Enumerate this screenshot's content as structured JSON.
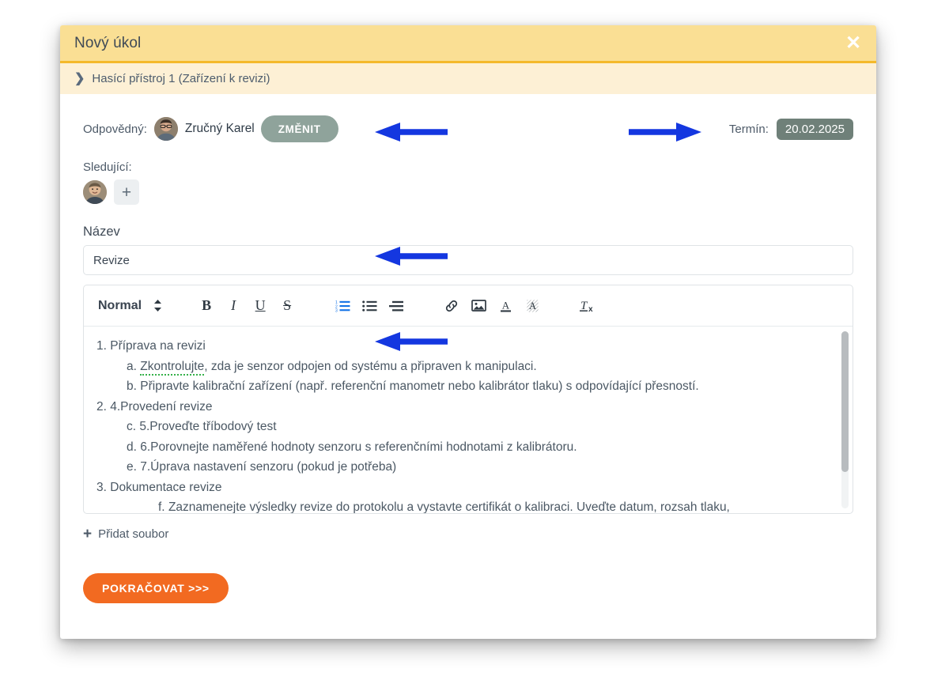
{
  "window": {
    "title": "Nový úkol",
    "close_label": "✕",
    "breadcrumb": {
      "chevron": "❯",
      "text": "Hasící přístroj 1 (Zařízení k revizi)"
    }
  },
  "form": {
    "responsible": {
      "label": "Odpovědný:",
      "name": "Zručný Karel",
      "change_button": "ZMĚNIT"
    },
    "deadline": {
      "label": "Termín:",
      "value": "20.02.2025"
    },
    "watchers": {
      "label": "Sledující:",
      "add_label": "+"
    },
    "title_field": {
      "label": "Název",
      "value": "Revize",
      "placeholder": "Název"
    },
    "add_file": {
      "plus": "+",
      "label": "Přidat soubor"
    },
    "submit_label": "POKRAČOVAT >>>"
  },
  "editor": {
    "toolbar": {
      "format_select": "Normal",
      "bold": "B",
      "italic": "I",
      "underline": "U",
      "strike": "S",
      "clear_format": "T",
      "clear_format_sub": "x",
      "icons": [
        "chevron-updown-icon",
        "bold-icon",
        "italic-icon",
        "underline-icon",
        "strikethrough-icon",
        "ordered-list-icon",
        "bullet-list-icon",
        "outdent-icon",
        "link-icon",
        "image-icon",
        "text-color-icon",
        "highlight-color-icon",
        "clear-format-icon"
      ],
      "active_icon": "ordered-list-icon",
      "active_color": "#1473e6"
    },
    "content": [
      {
        "indent": 0,
        "marker": "1.",
        "text": "Příprava na revizi"
      },
      {
        "indent": 1,
        "marker": "a.",
        "text_pre": "",
        "spell": "Zkontrolujte",
        "text": ", zda je senzor odpojen od systému a připraven k manipulaci."
      },
      {
        "indent": 1,
        "marker": "b.",
        "text": "Připravte kalibrační zařízení (např. referenční manometr nebo kalibrátor tlaku) s odpovídající přesností."
      },
      {
        "indent": 0,
        "marker": "2.",
        "text": "4.Provedení revize"
      },
      {
        "indent": 1,
        "marker": "c.",
        "text": "5.Proveďte tříbodový test"
      },
      {
        "indent": 1,
        "marker": "d.",
        "text": "6.Porovnejte naměřené hodnoty senzoru s referenčními hodnotami z kalibrátoru."
      },
      {
        "indent": 1,
        "marker": "e.",
        "text": "7.Úprava nastavení senzoru (pokud je potřeba)"
      },
      {
        "indent": 0,
        "marker": "3.",
        "text": "Dokumentace revize"
      },
      {
        "indent": 1,
        "marker": "f.",
        "text": "Zaznamenejte výsledky revize do protokolu a vystavte certifikát o kalibraci. Uveďte datum, rozsah tlaku,"
      }
    ]
  },
  "annotations": {
    "color": "#1437e0",
    "arrows": [
      {
        "name": "arrow-pointing-change-button",
        "direction": "left"
      },
      {
        "name": "arrow-pointing-deadline",
        "direction": "right"
      },
      {
        "name": "arrow-pointing-title-input",
        "direction": "left"
      },
      {
        "name": "arrow-pointing-editor-content",
        "direction": "left"
      }
    ]
  },
  "colors": {
    "header_bg": "#fadf94",
    "header_border": "#f4b92b",
    "breadcrumb_bg": "#fdf0d5",
    "change_button_bg": "#8fa39b",
    "deadline_bg": "#6f8079",
    "submit_bg": "#f26a21",
    "accent_blue": "#1473e6",
    "spellcheck_green": "#35b14a"
  }
}
